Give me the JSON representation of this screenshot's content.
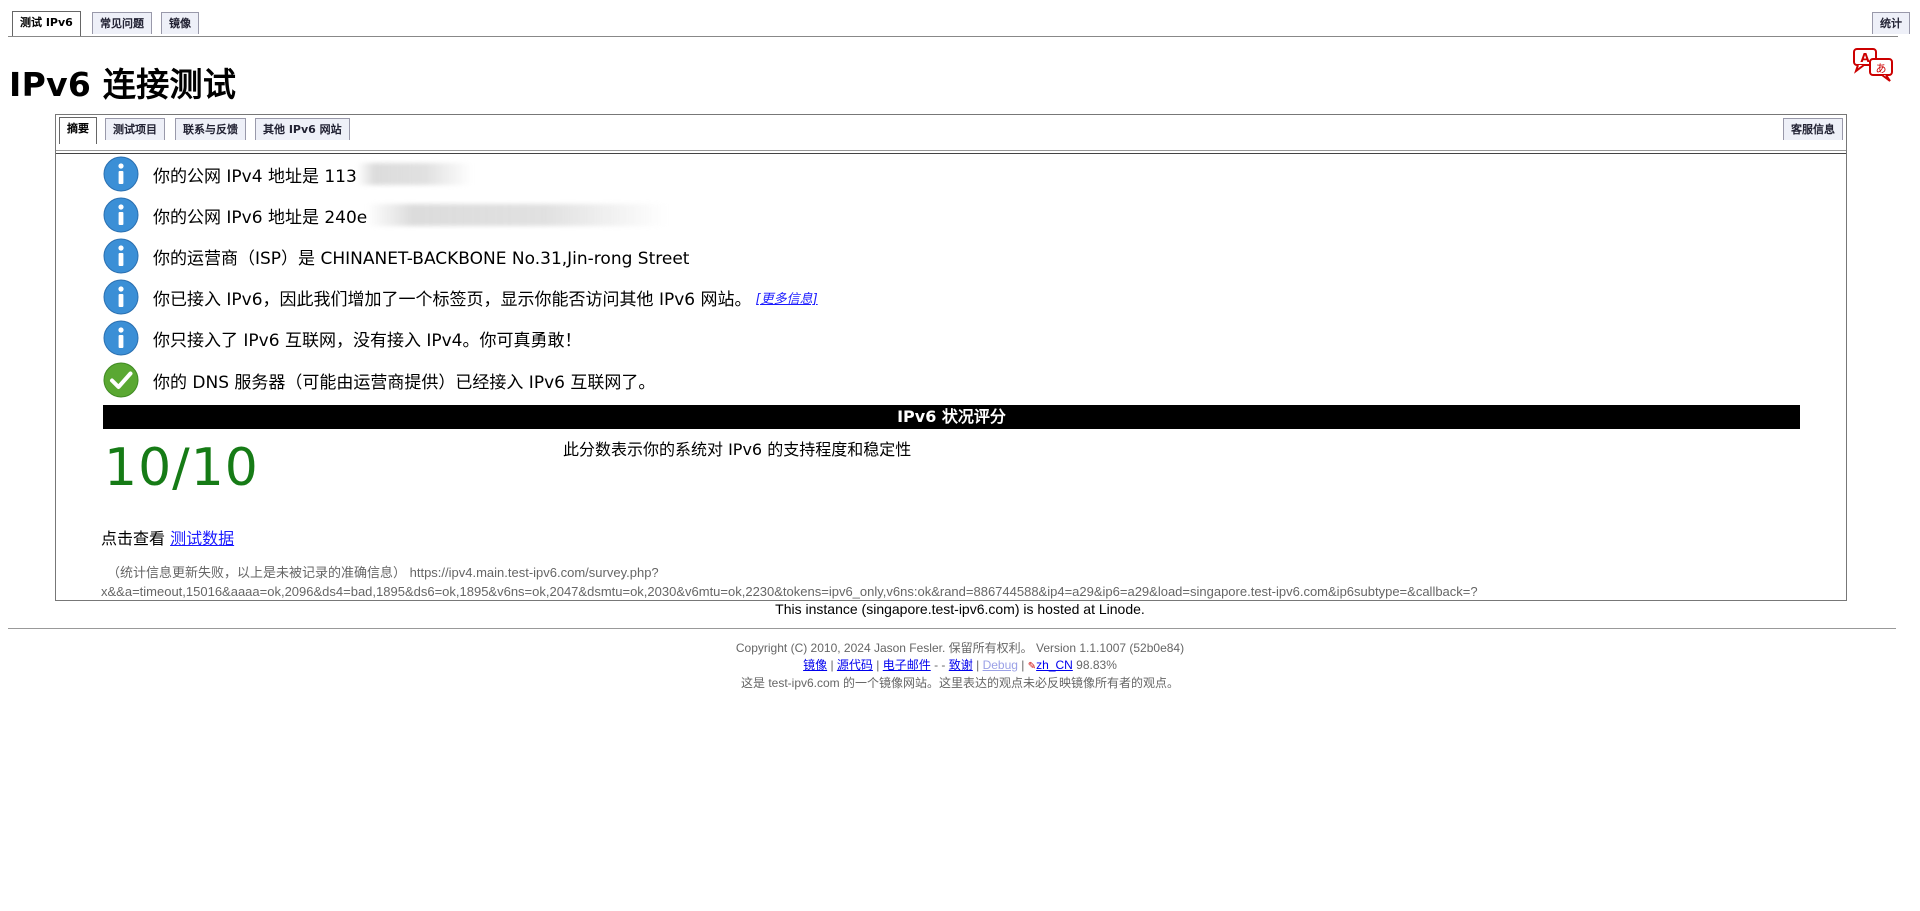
{
  "top_tabs": {
    "test": "测试 IPv6",
    "faq": "常见问题",
    "mirror": "镜像",
    "stats": "统计"
  },
  "title": "IPv6 连接测试",
  "inner_tabs": {
    "summary": "摘要",
    "tests": "测试项目",
    "contact": "联系与反馈",
    "other_sites": "其他 IPv6 网站",
    "help_desk": "客服信息"
  },
  "messages": [
    {
      "icon": "info-icon",
      "prefix": "你的公网 IPv4 地址是 113",
      "blurred": true
    },
    {
      "icon": "info-icon",
      "prefix": "你的公网 IPv6 地址是 240e",
      "blurred": true
    },
    {
      "icon": "info-icon",
      "text": "你的运营商（ISP）是 CHINANET-BACKBONE No.31,Jin-rong Street"
    },
    {
      "icon": "info-icon",
      "text": "你已接入 IPv6，因此我们增加了一个标签页，显示你能否访问其他 IPv6 网站。",
      "link": "[更多信息]"
    },
    {
      "icon": "info-icon",
      "text": "你只接入了 IPv6 互联网，没有接入 IPv4。你可真勇敢！"
    },
    {
      "icon": "check-icon",
      "text": "你的 DNS 服务器（可能由运营商提供）已经接入 IPv6 互联网了。"
    }
  ],
  "score": {
    "header": "IPv6 状况评分",
    "value": "10/10",
    "description": "此分数表示你的系统对 IPv6 的支持程度和稳定性"
  },
  "view_data": {
    "prefix": "点击查看 ",
    "link": "测试数据"
  },
  "survey": {
    "line1": "（统计信息更新失败，以上是未被记录的准确信息） https://ipv4.main.test-ipv6.com/survey.php?",
    "line2": "x&&a=timeout,15016&aaaa=ok,2096&ds4=bad,1895&ds6=ok,1895&v6ns=ok,2047&dsmtu=ok,2030&v6mtu=ok,2230&tokens=ipv6_only,v6ns:ok&rand=886744588&ip4=a29&ip6=a29&load=singapore.test-ipv6.com&ip6subtype=&callback=?"
  },
  "hosted": "This instance (singapore.test-ipv6.com) is hosted at Linode.",
  "footer": {
    "copyright": "Copyright (C) 2010, 2024 Jason Fesler. 保留所有权利。 Version 1.1.1007 (52b0e84)",
    "links": {
      "mirrors": "镜像",
      "source": "源代码",
      "email": "电子邮件",
      "sep_dash": " - ",
      "thanks": "致谢",
      "debug": "Debug",
      "locale": "zh_CN",
      "percent": "98.83%"
    },
    "disclaimer": "这是 test-ipv6.com 的一个镜像网站。这里表达的观点未必反映镜像所有者的观点。"
  },
  "colors": {
    "score": "#167b16",
    "info_icon": "#3b8fd6",
    "check_icon": "#5aa832",
    "link": "#1a1aff"
  }
}
